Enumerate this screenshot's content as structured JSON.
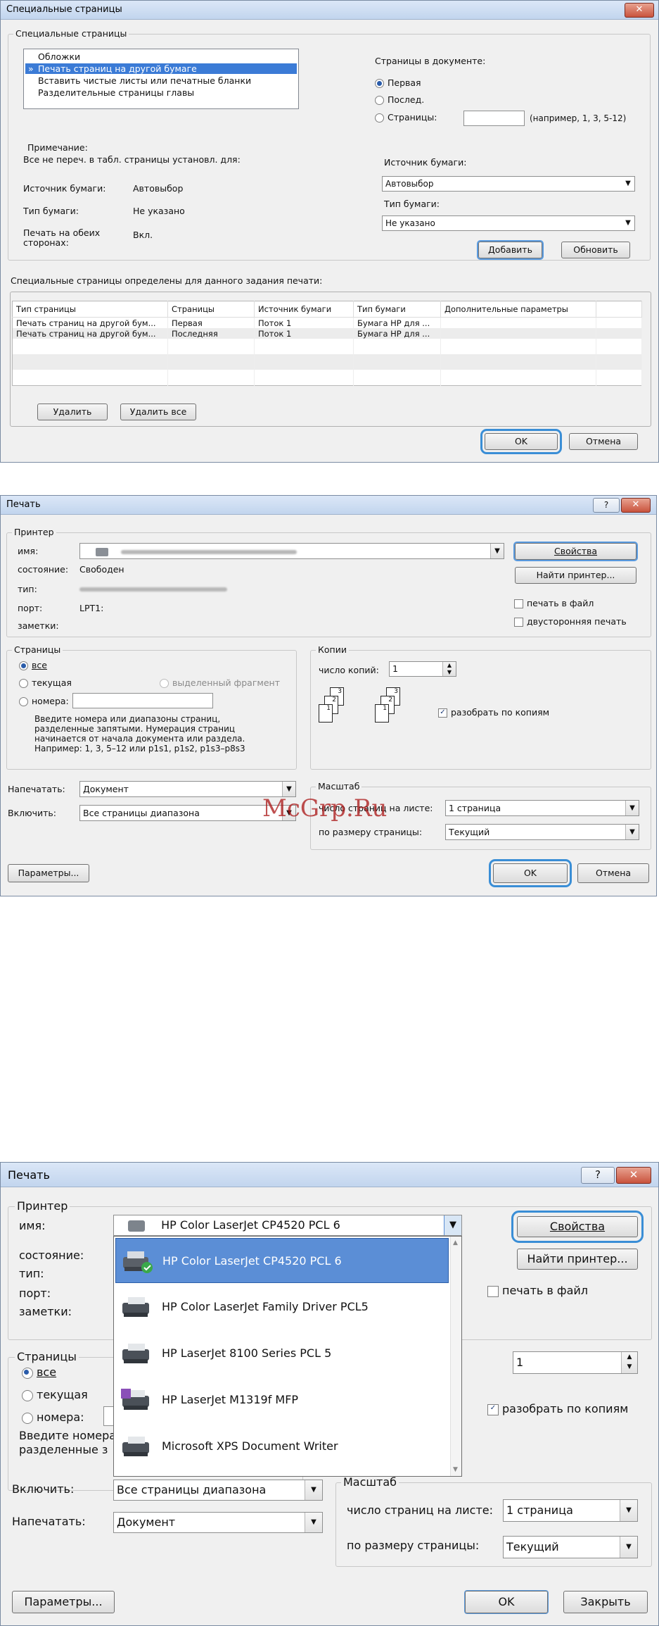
{
  "d1": {
    "title": "Специальные страницы",
    "group_label": "Специальные страницы",
    "list_items": [
      "Обложки",
      "Печать страниц на другой бумаге",
      "Вставить чистые листы или печатные бланки",
      "Разделительные страницы главы"
    ],
    "selected_marker": "»",
    "pages_in_doc_label": "Страницы в документе:",
    "radio_first": "Первая",
    "radio_last": "Послед.",
    "radio_pages": "Страницы:",
    "pages_hint": "(например, 1, 3, 5-12)",
    "note_label": "Примечание:",
    "note_text": "Все не переч. в  табл. страницы установл. для:",
    "src_label": "Источник бумаги:",
    "src_value": "Автовыбор",
    "type_label": "Тип бумаги:",
    "type_value": "Не указано",
    "duplex_label": "Печать на обеих сторонах:",
    "duplex_value": "Вкл.",
    "right_src_label": "Источник бумаги:",
    "right_src_value": "Автовыбор",
    "right_type_label": "Тип бумаги:",
    "right_type_value": "Не указано",
    "add_button": "Добавить",
    "update_button": "Обновить",
    "defined_label": "Специальные страницы определены для данного задания печати:",
    "table_headers": [
      "Тип страницы",
      "Страницы",
      "Источник бумаги",
      "Тип бумаги",
      "Дополнительные параметры"
    ],
    "table_rows": [
      [
        "Печать страниц на другой бум...",
        "Первая",
        "Поток 1",
        "Бумага HP для ...",
        ""
      ],
      [
        "Печать страниц на другой бум...",
        "Последняя",
        "Поток 1",
        "Бумага HP для ...",
        ""
      ]
    ],
    "delete_button": "Удалить",
    "delete_all_button": "Удалить все",
    "ok_button": "OK",
    "cancel_button": "Отмена",
    "close_glyph": "✕"
  },
  "d2": {
    "title": "Печать",
    "help_glyph": "?",
    "close_glyph": "✕",
    "printer_group": "Принтер",
    "name_label": "имя:",
    "status_label": "состояние:",
    "status_value": "Свободен",
    "type_label": "тип:",
    "port_label": "порт:",
    "port_value": "LPT1:",
    "notes_label": "заметки:",
    "properties_button": "Свойства",
    "find_printer_button": "Найти принтер...",
    "print_to_file": "печать в файл",
    "duplex": "двусторонняя печать",
    "pages_group": "Страницы",
    "radio_all": "все",
    "radio_current": "текущая",
    "radio_selection": "выделенный фрагмент",
    "radio_numbers": "номера:",
    "pages_help": [
      "Введите номера или диапазоны страниц,",
      "разделенные запятыми. Нумерация страниц",
      "начинается от начала документа или раздела.",
      "Например: 1, 3, 5–12 или p1s1, p1s2, p1s3–p8s3"
    ],
    "copies_group": "Копии",
    "copies_label": "число копий:",
    "copies_value": "1",
    "collate": "разобрать по копиям",
    "print_what_label": "Напечатать:",
    "print_what_value": "Документ",
    "include_label": "Включить:",
    "include_value": "Все страницы диапазона",
    "zoom_group": "Масштаб",
    "pages_per_sheet_label": "число страниц на листе:",
    "pages_per_sheet_value": "1 страница",
    "scale_label": "по размеру страницы:",
    "scale_value": "Текущий",
    "watermark": "McGrp.Ru",
    "options_button": "Параметры...",
    "ok_button": "OK",
    "cancel_button": "Отмена"
  },
  "d3": {
    "title": "Печать",
    "help_glyph": "?",
    "close_glyph": "✕",
    "printer_group": "Принтер",
    "name_label": "имя:",
    "name_value": "HP Color LaserJet CP4520 PCL 6",
    "status_label": "состояние:",
    "type_label": "тип:",
    "port_label": "порт:",
    "notes_label": "заметки:",
    "properties_button": "Свойства",
    "find_printer_button": "Найти принтер...",
    "print_to_file": "печать в файл",
    "pages_group": "Страницы",
    "radio_all": "все",
    "radio_current": "текущая",
    "radio_numbers": "номера:",
    "pages_help": [
      "Введите номера",
      "разделенные з"
    ],
    "copies_value": "1",
    "collate": "разобрать по копиям",
    "dropdown_items": [
      "HP Color LaserJet CP4520 PCL 6",
      "HP Color LaserJet Family Driver PCL5",
      "HP LaserJet 8100 Series PCL 5",
      "HP LaserJet M1319f MFP",
      "Microsoft XPS Document Writer"
    ],
    "include_label": "Включить:",
    "include_value": "Все страницы диапазона",
    "print_what_label": "Напечатать:",
    "print_what_value": "Документ",
    "zoom_group": "Масштаб",
    "pages_per_sheet_label": "число страниц на листе:",
    "pages_per_sheet_value": "1 страница",
    "scale_label": "по размеру страницы:",
    "scale_value": "Текущий",
    "options_button": "Параметры...",
    "ok_button": "OK",
    "close_button": "Закрыть"
  }
}
